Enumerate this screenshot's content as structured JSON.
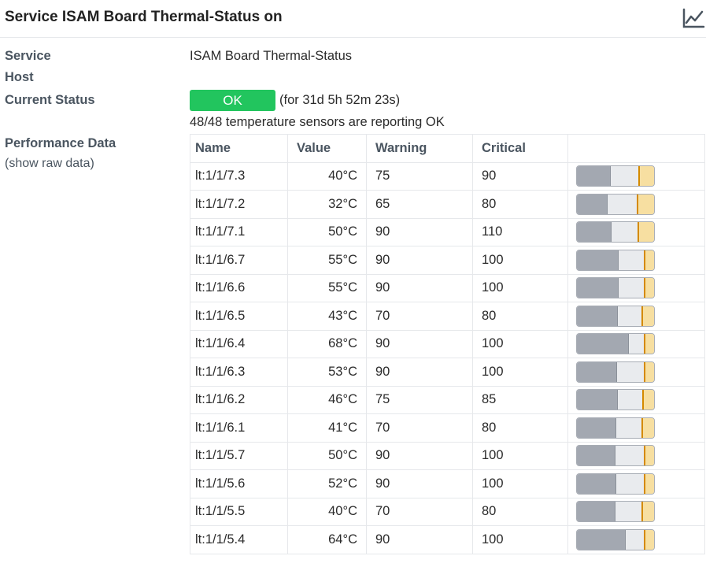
{
  "header": {
    "title": "Service ISAM Board Thermal-Status on"
  },
  "details": {
    "service_label": "Service",
    "service_value": "ISAM Board Thermal-Status",
    "host_label": "Host",
    "status_label": "Current Status",
    "status_value": "OK",
    "status_duration": "(for 31d 5h 52m 23s)",
    "status_output": "48/48 temperature sensors are reporting OK",
    "perf_label": "Performance Data",
    "raw_link": "(show raw data)"
  },
  "perf_table": {
    "columns": [
      "Name",
      "Value",
      "Warning",
      "Critical",
      ""
    ],
    "rows": [
      {
        "name": "lt:1/1/7.3",
        "value": "40°C",
        "warning": "75",
        "critical": "90",
        "v": 40,
        "w": 75,
        "c": 90
      },
      {
        "name": "lt:1/1/7.2",
        "value": "32°C",
        "warning": "65",
        "critical": "80",
        "v": 32,
        "w": 65,
        "c": 80
      },
      {
        "name": "lt:1/1/7.1",
        "value": "50°C",
        "warning": "90",
        "critical": "110",
        "v": 50,
        "w": 90,
        "c": 110
      },
      {
        "name": "lt:1/1/6.7",
        "value": "55°C",
        "warning": "90",
        "critical": "100",
        "v": 55,
        "w": 90,
        "c": 100
      },
      {
        "name": "lt:1/1/6.6",
        "value": "55°C",
        "warning": "90",
        "critical": "100",
        "v": 55,
        "w": 90,
        "c": 100
      },
      {
        "name": "lt:1/1/6.5",
        "value": "43°C",
        "warning": "70",
        "critical": "80",
        "v": 43,
        "w": 70,
        "c": 80
      },
      {
        "name": "lt:1/1/6.4",
        "value": "68°C",
        "warning": "90",
        "critical": "100",
        "v": 68,
        "w": 90,
        "c": 100
      },
      {
        "name": "lt:1/1/6.3",
        "value": "53°C",
        "warning": "90",
        "critical": "100",
        "v": 53,
        "w": 90,
        "c": 100
      },
      {
        "name": "lt:1/1/6.2",
        "value": "46°C",
        "warning": "75",
        "critical": "85",
        "v": 46,
        "w": 75,
        "c": 85
      },
      {
        "name": "lt:1/1/6.1",
        "value": "41°C",
        "warning": "70",
        "critical": "80",
        "v": 41,
        "w": 70,
        "c": 80
      },
      {
        "name": "lt:1/1/5.7",
        "value": "50°C",
        "warning": "90",
        "critical": "100",
        "v": 50,
        "w": 90,
        "c": 100
      },
      {
        "name": "lt:1/1/5.6",
        "value": "52°C",
        "warning": "90",
        "critical": "100",
        "v": 52,
        "w": 90,
        "c": 100
      },
      {
        "name": "lt:1/1/5.5",
        "value": "40°C",
        "warning": "70",
        "critical": "80",
        "v": 40,
        "w": 70,
        "c": 80
      },
      {
        "name": "lt:1/1/5.4",
        "value": "64°C",
        "warning": "90",
        "critical": "100",
        "v": 64,
        "w": 90,
        "c": 100
      }
    ]
  },
  "colors": {
    "ok": "#22c55e",
    "bar_fill": "#a3a8b1",
    "warn_zone": "#f7dfa1",
    "warn_line": "#d48a00"
  },
  "icons": {
    "graph": "line-chart-icon"
  }
}
